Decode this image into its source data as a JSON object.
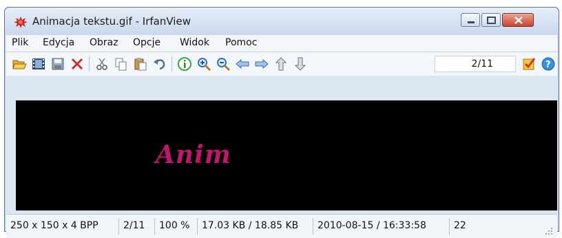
{
  "window": {
    "title": "Animacja tekstu.gif - IrfanView"
  },
  "menubar": {
    "items": [
      "Plik",
      "Edycja",
      "Obraz",
      "Opcje",
      "Widok",
      "Pomoc"
    ]
  },
  "toolbar": {
    "icons": [
      "open-folder-icon",
      "filmstrip-icon",
      "save-icon",
      "delete-icon",
      "cut-icon",
      "copy-icon",
      "paste-icon",
      "undo-icon",
      "info-icon",
      "zoom-in-icon",
      "zoom-out-icon",
      "previous-icon",
      "next-icon",
      "first-icon",
      "last-icon",
      "options-checkbox-icon",
      "help-icon"
    ],
    "page_value": "2/11"
  },
  "viewer": {
    "animated_text": "Anim"
  },
  "statusbar": {
    "dimensions": "250 x 150 x 4 BPP",
    "page": "2/11",
    "zoom": "100 %",
    "file_size": "17.03 KB / 18.85 KB",
    "datetime": "2010-08-15 / 16:33:58",
    "frame_delay": "22"
  },
  "colors": {
    "accent_text": "#c0176e",
    "titlebar": "#cddcf0",
    "close_button": "#c8452e"
  }
}
